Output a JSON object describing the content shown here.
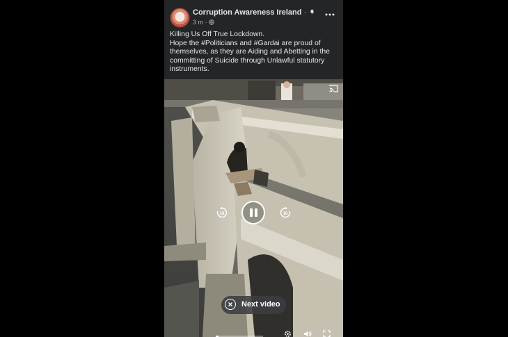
{
  "post": {
    "author": "Corruption Awareness Ireland",
    "follow_dot": "·",
    "time": "3 m",
    "meta_separator": "·",
    "audience_icon": "globe-icon",
    "text_line1": "Killing Us Off True Lockdown.",
    "text_line2": "Hope the #Politicians and #Gardai are proud of themselves, as they are Aiding and Abetting in the committing of Suicide through Unlawful statutory instruments."
  },
  "video": {
    "state": "playing",
    "rewind_seconds": "10",
    "forward_seconds": "10",
    "next_video_label": "Next video",
    "time": "",
    "progress": 0.06
  },
  "icons": {
    "more": "more-horizontal-icon",
    "notification": "bell-icon",
    "cast": "cast-icon",
    "settings": "gear-icon",
    "volume": "volume-icon",
    "fullscreen": "fullscreen-icon"
  },
  "colors": {
    "card_background": "#242526",
    "text_primary": "#e4e6eb",
    "text_secondary": "#b0b3b8",
    "page_background": "#000000"
  }
}
